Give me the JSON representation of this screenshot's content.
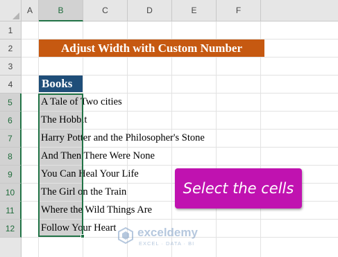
{
  "columns": [
    "A",
    "B",
    "C",
    "D",
    "E",
    "F"
  ],
  "rows": [
    "1",
    "2",
    "3",
    "4",
    "5",
    "6",
    "7",
    "8",
    "9",
    "10",
    "11",
    "12"
  ],
  "title": "Adjust Width with Custom Number",
  "header": "Books",
  "books": [
    "A Tale of Two cities",
    "The Hobbit",
    "Harry Potter and the Philosopher's Stone",
    "And Then There Were None",
    "You Can Heal Your Life",
    "The Girl on the Train",
    "Where the Wild Things Are",
    "Follow Your Heart"
  ],
  "callout": "Select the cells",
  "watermark": {
    "name": "exceldemy",
    "tagline": "EXCEL · DATA · BI"
  },
  "colors": {
    "title_bg": "#c65911",
    "header_bg": "#1f4e79",
    "selection": "#217346",
    "callout_bg": "#c012b0"
  }
}
